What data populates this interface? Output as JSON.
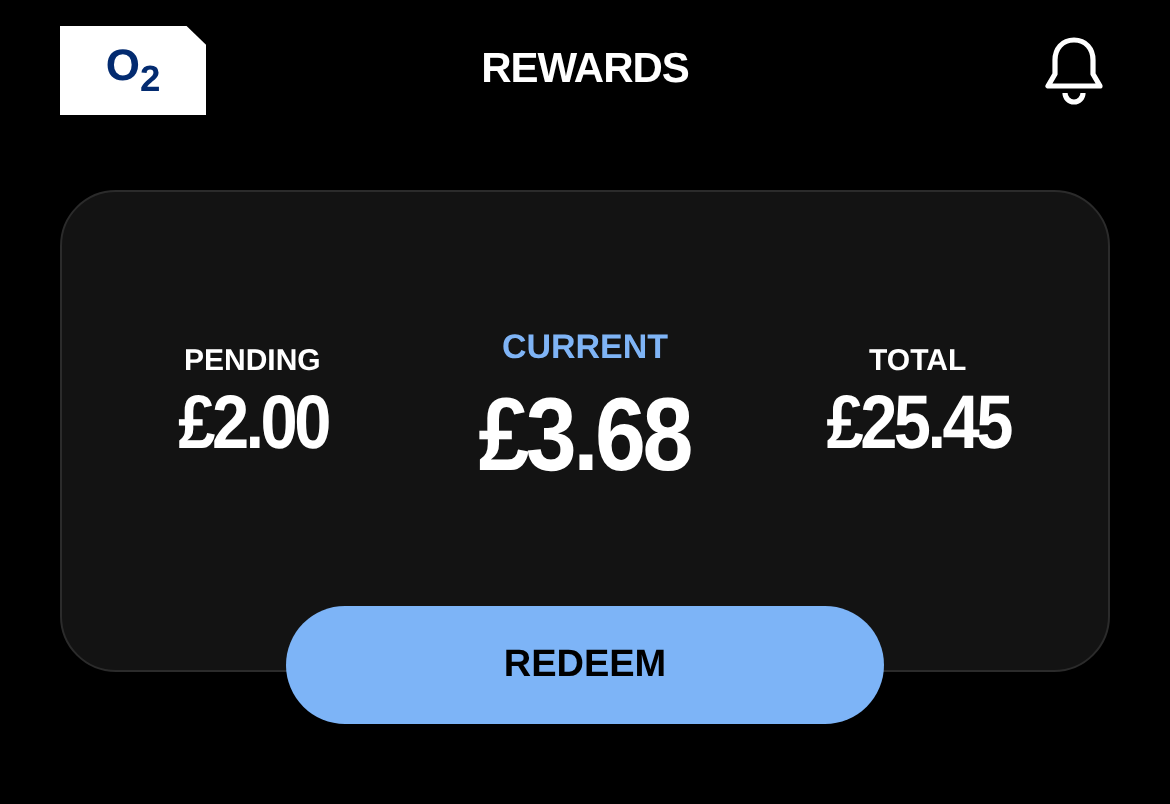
{
  "header": {
    "logo": "O$_{2}$",
    "title": "REWARDS"
  },
  "balances": [
    {
      "label": "PENDING",
      "amount": "£2.00",
      "highlighted": false
    },
    {
      "label": "CURRENT",
      "amount": "£3.68",
      "highlighted": true
    },
    {
      "label": "TOTAL",
      "amount": "£25.45",
      "highlighted": false
    }
  ],
  "button": "REDEEM"
}
